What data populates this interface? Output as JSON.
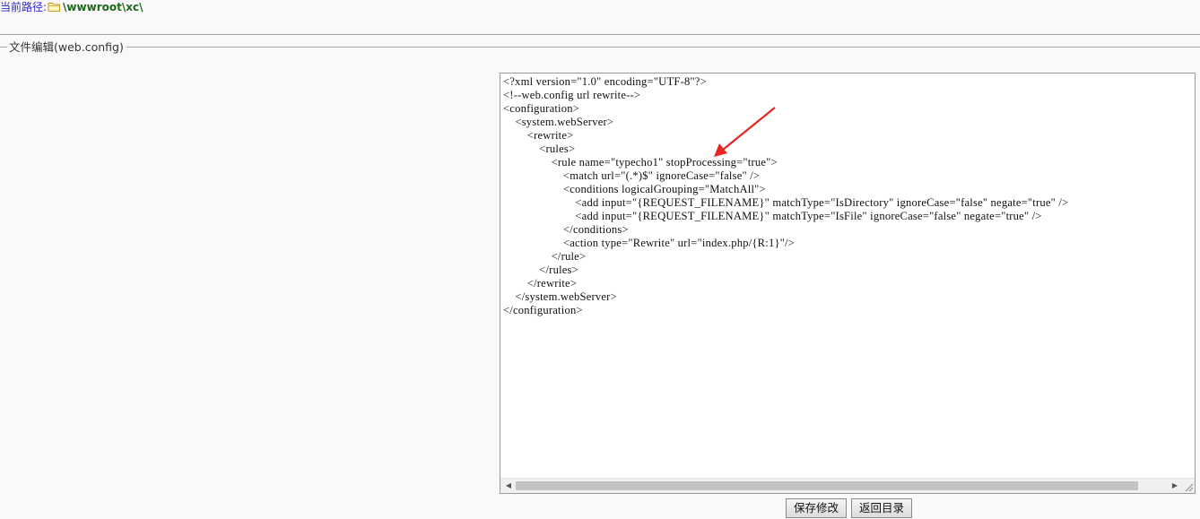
{
  "path_bar": {
    "label": "当前路径:",
    "folder_icon": "folder-icon",
    "value": "\\wwwroot\\xc\\"
  },
  "section": {
    "legend": "文件编辑(web.config)"
  },
  "editor": {
    "content": "<?xml version=\"1.0\" encoding=\"UTF-8\"?>\n<!--web.config url rewrite-->\n<configuration>\n    <system.webServer>\n        <rewrite>\n            <rules>\n                <rule name=\"typecho1\" stopProcessing=\"true\">\n                    <match url=\"(.*)$\" ignoreCase=\"false\" />\n                    <conditions logicalGrouping=\"MatchAll\">\n                        <add input=\"{REQUEST_FILENAME}\" matchType=\"IsDirectory\" ignoreCase=\"false\" negate=\"true\" />\n                        <add input=\"{REQUEST_FILENAME}\" matchType=\"IsFile\" ignoreCase=\"false\" negate=\"true\" />\n                    </conditions>\n                    <action type=\"Rewrite\" url=\"index.php/{R:1}\"/>\n                </rule>\n            </rules>\n        </rewrite>\n    </system.webServer>\n</configuration>"
  },
  "buttons": {
    "save_label": "保存修改",
    "back_label": "返回目录"
  },
  "annotation": {
    "arrow_color": "#e8251f"
  }
}
